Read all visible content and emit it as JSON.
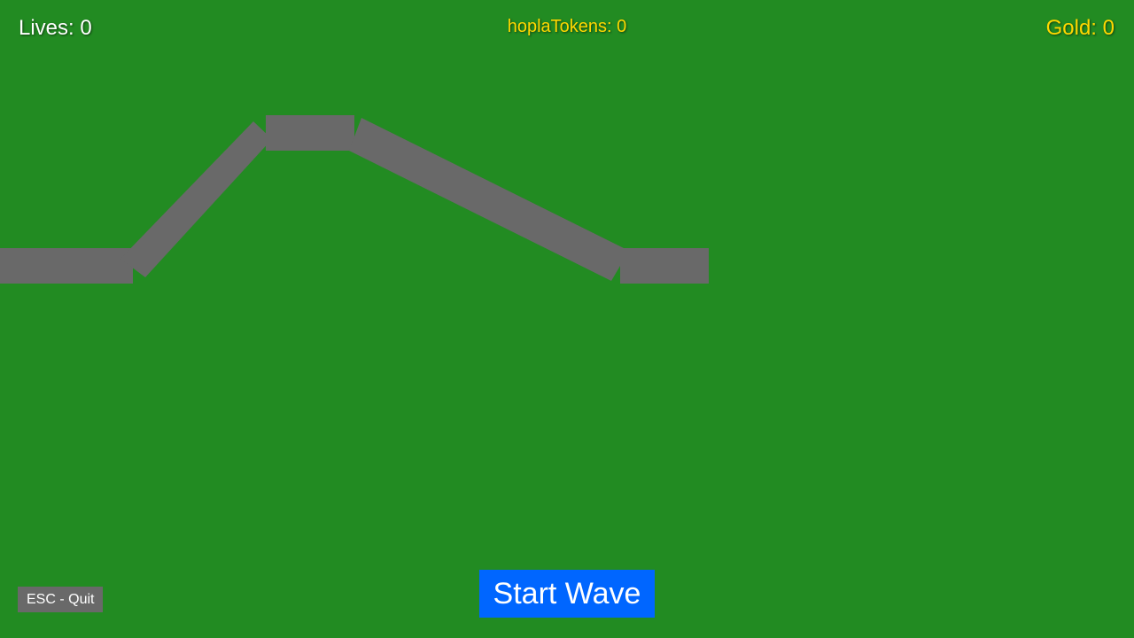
{
  "hud": {
    "lives_label": "Lives: 0",
    "tokens_label": "hoplaTokens: 0",
    "gold_label": "Gold: 0"
  },
  "controls": {
    "start_wave_label": "Start Wave",
    "quit_label": "ESC - Quit"
  },
  "colors": {
    "grass": "#228b22",
    "path": "#696969",
    "gold_text": "#ffd700",
    "start_button": "#0066ff"
  }
}
